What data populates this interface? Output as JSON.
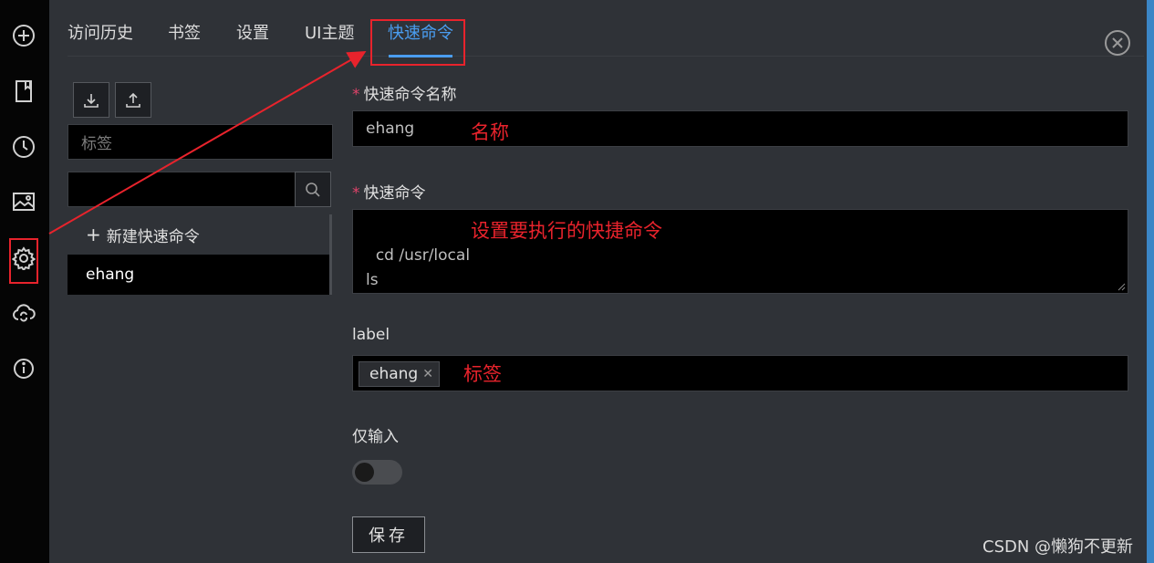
{
  "tabs": [
    {
      "label": "访问历史"
    },
    {
      "label": "书签"
    },
    {
      "label": "设置"
    },
    {
      "label": "UI主题"
    },
    {
      "label": "快速命令",
      "active": true
    }
  ],
  "sidebar": {
    "icons": [
      "add-circle-icon",
      "book-icon",
      "clock-icon",
      "image-icon",
      "gear-icon",
      "cloud-sync-icon",
      "info-icon"
    ],
    "active": "gear-icon"
  },
  "left_panel": {
    "tag_filter_placeholder": "标签",
    "search_value": "",
    "new_command_label": "新建快速命令",
    "items": [
      "ehang"
    ]
  },
  "form": {
    "name_label": "快速命令名称",
    "name_value": "ehang",
    "command_label": "快速命令",
    "command_value": "cd /usr/local\nls",
    "tag_label": "label",
    "tags": [
      "ehang"
    ],
    "input_only_label": "仅输入",
    "input_only_on": false,
    "save_label": "保存"
  },
  "annotations": {
    "name": "名称",
    "command": "设置要执行的快捷命令",
    "tag": "标签"
  },
  "watermark": "CSDN @懒狗不更新",
  "colors": {
    "accent": "#4a9df0",
    "annotation": "#e8232c",
    "required": "#e0436a",
    "background": "#2f3237",
    "sidebar": "#050505",
    "input": "#000000"
  }
}
